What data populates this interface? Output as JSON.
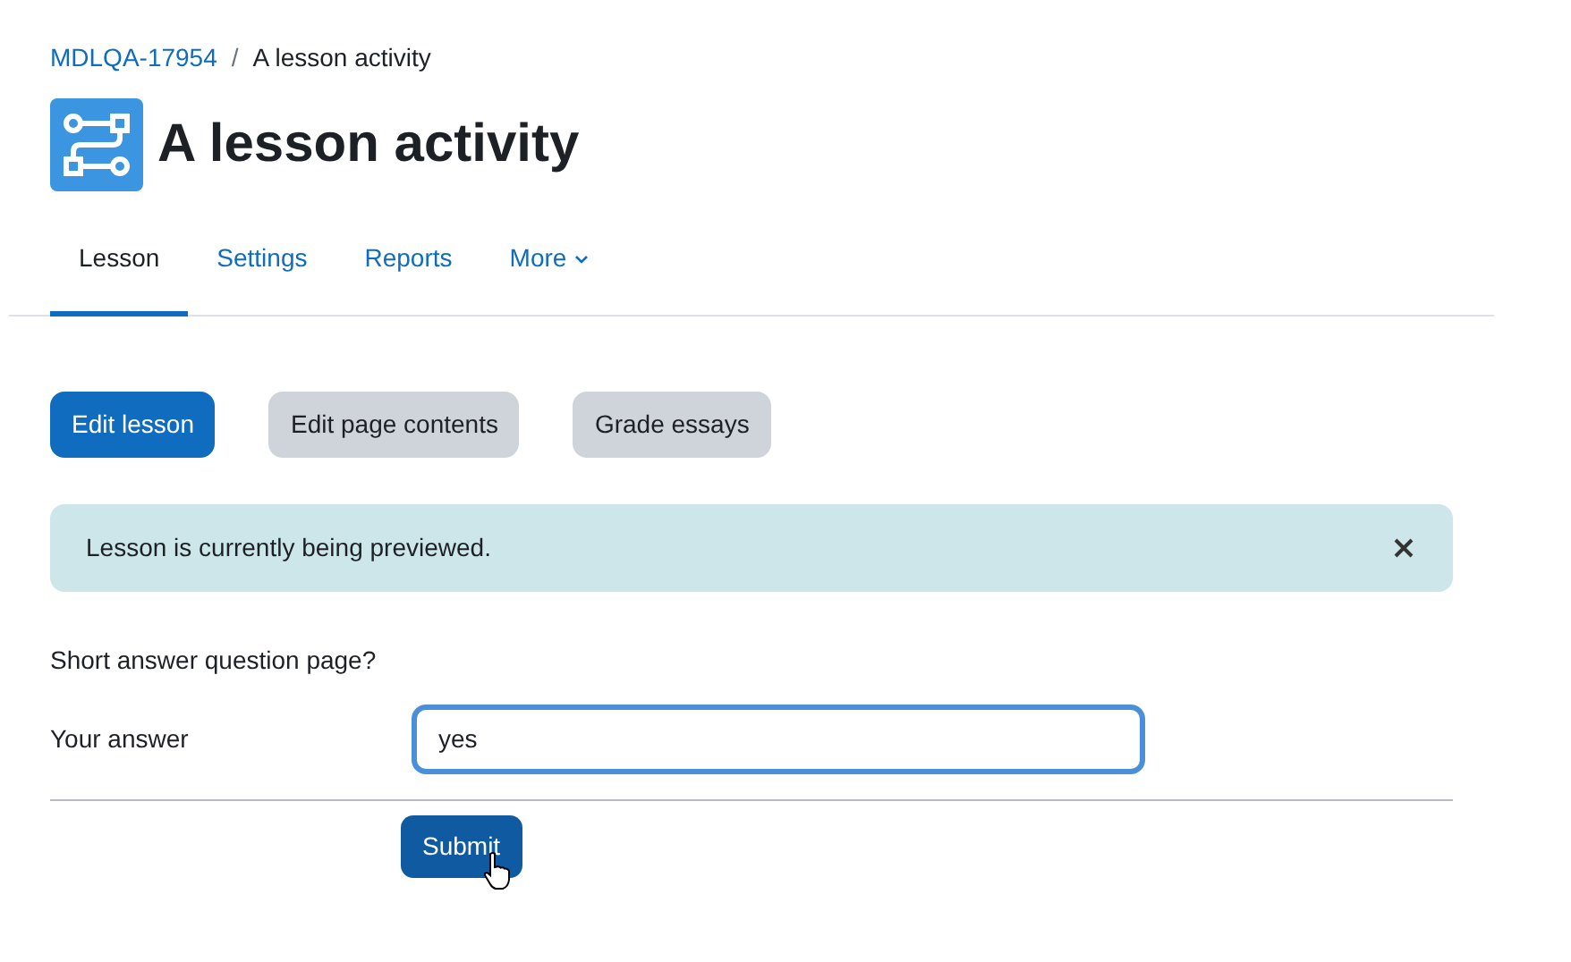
{
  "breadcrumb": [
    {
      "label": "MDLQA-17954",
      "kind": "link"
    },
    {
      "label": "/",
      "kind": "separator"
    },
    {
      "label": "A lesson activity",
      "kind": "current"
    }
  ],
  "title": "A lesson activity",
  "tabs": [
    {
      "label": "Lesson",
      "selected": true,
      "kind": "tab"
    },
    {
      "label": "Settings",
      "selected": false,
      "kind": "tab"
    },
    {
      "label": "Reports",
      "selected": false,
      "kind": "tab"
    },
    {
      "label": "More",
      "selected": false,
      "kind": "dropdown"
    }
  ],
  "actions": [
    {
      "label": "Edit lesson",
      "kind": "primary"
    },
    {
      "label": "Edit page contents",
      "kind": "secondary"
    },
    {
      "label": "Grade essays",
      "kind": "secondary"
    }
  ],
  "alert": {
    "text": "Lesson is currently being previewed.",
    "dismissible": true
  },
  "question": {
    "text": "Short answer question page?",
    "label": "Your answer",
    "value": "yes",
    "focused": true,
    "submit": "Submit"
  }
}
